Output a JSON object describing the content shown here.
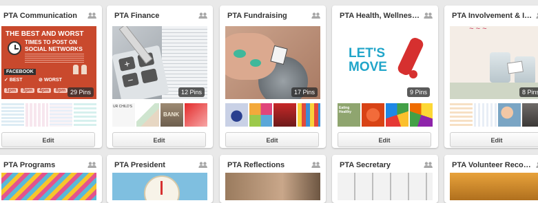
{
  "boards": [
    {
      "title": "PTA Communication",
      "pin_count": "29 Pins",
      "edit_label": "Edit",
      "cover": {
        "headline_1": "THE BEST AND WORST",
        "headline_2": "TIMES TO POST ON",
        "headline_3": "SOCIAL NETWORKS",
        "platform": "FACEBOOK",
        "best_label": "BEST",
        "worst_label": "WORST",
        "times": [
          "1pm",
          "3pm",
          "4pm",
          "8pm"
        ]
      }
    },
    {
      "title": "PTA Finance",
      "pin_count": "12 Pins",
      "edit_label": "Edit",
      "thumb_text": [
        "UR CHILD'S",
        "BANK"
      ]
    },
    {
      "title": "PTA Fundraising",
      "pin_count": "17 Pins",
      "edit_label": "Edit"
    },
    {
      "title": "PTA Health, Wellness & S...",
      "pin_count": "9 Pins",
      "edit_label": "Edit",
      "cover_text": "LET'S MOVE",
      "thumb_text": [
        "Eating Healthy"
      ]
    },
    {
      "title": "PTA Involvement & Ideas",
      "pin_count": "8 Pins",
      "edit_label": "Edit"
    },
    {
      "title": "PTA Programs"
    },
    {
      "title": "PTA President"
    },
    {
      "title": "PTA Reflections"
    },
    {
      "title": "PTA Secretary"
    },
    {
      "title": "PTA Volunteer Recognition"
    }
  ]
}
